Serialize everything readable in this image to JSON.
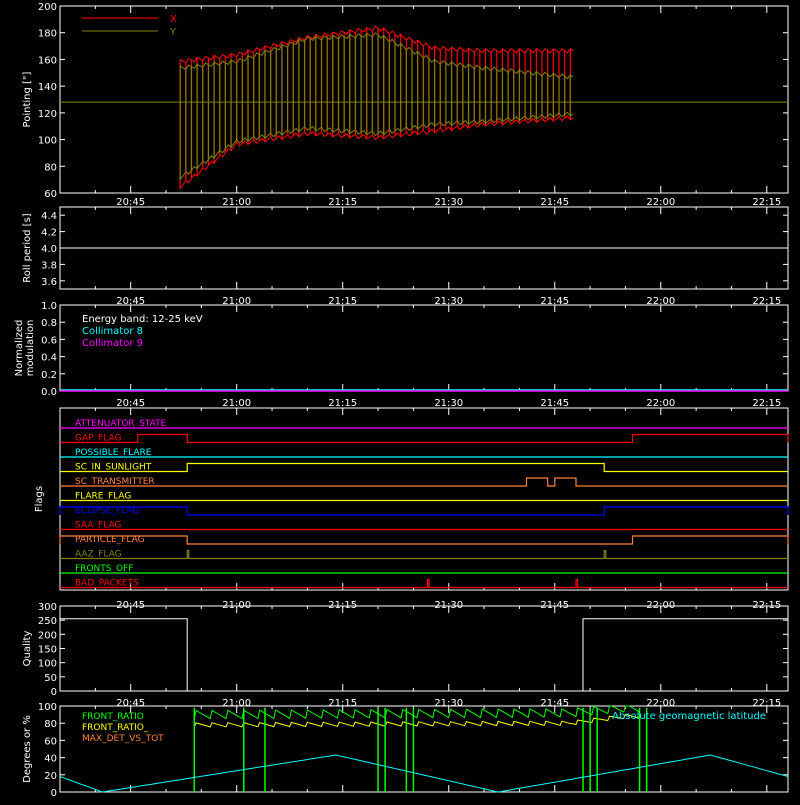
{
  "colors": {
    "background": "#000000",
    "axis": "#ffffff",
    "x": "#ff0000",
    "y": "#808000",
    "collimator8": "#00ffff",
    "collimator9": "#ff00ff",
    "front_ratio": "#00ff00",
    "front_ratio2": "#ffff00",
    "max_det": "#ff8040",
    "latitude": "#00ffff"
  },
  "time_axis": {
    "range": [
      "20:35",
      "22:18"
    ],
    "tick_labels": [
      "20:45",
      "21:00",
      "21:15",
      "21:30",
      "21:45",
      "22:00",
      "22:15"
    ]
  },
  "chart_data": [
    {
      "type": "line",
      "ylabel": "Pointing [\"]",
      "ylim": [
        60,
        200
      ],
      "yticks": [
        "60",
        "80",
        "100",
        "120",
        "140",
        "160",
        "180",
        "200"
      ],
      "legend_position": "top-left",
      "series": [
        {
          "name": "X",
          "time_span": [
            "20:52",
            "21:48"
          ],
          "envelope_time": [
            "20:52",
            "21:00",
            "21:10",
            "21:20",
            "21:28",
            "21:35",
            "21:48"
          ],
          "upper": [
            160,
            165,
            178,
            185,
            170,
            168,
            168
          ],
          "lower": [
            63,
            95,
            103,
            100,
            105,
            110,
            115
          ]
        },
        {
          "name": "Y",
          "time_span": [
            "20:52",
            "21:48"
          ],
          "envelope_time": [
            "20:52",
            "21:00",
            "21:10",
            "21:20",
            "21:28",
            "21:35",
            "21:48"
          ],
          "upper": [
            155,
            160,
            177,
            180,
            160,
            155,
            148
          ],
          "lower": [
            70,
            97,
            107,
            103,
            110,
            112,
            118
          ],
          "constant_line": 128
        }
      ]
    },
    {
      "type": "line",
      "ylabel": "Roll period [s]",
      "ylim": [
        3.5,
        4.5
      ],
      "yticks": [
        "3.6",
        "3.8",
        "4.0",
        "4.2",
        "4.4"
      ],
      "series": [
        {
          "x": [
            "20:35",
            "22:18"
          ],
          "values": [
            4.0,
            4.0
          ]
        }
      ]
    },
    {
      "type": "line",
      "ylabel": "Normalized modulation",
      "ylabel_lines": [
        "Normalized",
        "modulation"
      ],
      "ylim": [
        0,
        1
      ],
      "yticks": [
        "0.0",
        "0.2",
        "0.4",
        "0.6",
        "0.8",
        "1.0"
      ],
      "annotations": [
        "Energy band: 12-25 keV"
      ],
      "legend_position": "top-left",
      "series": [
        {
          "name": "Collimator 8",
          "values": [
            0,
            0
          ]
        },
        {
          "name": "Collimator 9",
          "values": [
            0,
            0
          ]
        }
      ]
    },
    {
      "type": "line",
      "ylabel": "Flags",
      "flags": [
        {
          "name": "ATTENUATOR_STATE",
          "color": "#ff00ff",
          "segments": []
        },
        {
          "name": "GAP_FLAG",
          "color": "#ff0000",
          "segments": [
            [
              "20:46",
              "20:53"
            ],
            [
              "21:56",
              "22:18"
            ]
          ]
        },
        {
          "name": "POSSIBLE_FLARE",
          "color": "#00ffff",
          "segments": []
        },
        {
          "name": "SC_IN_SUNLIGHT",
          "color": "#ffff00",
          "segments": [
            [
              "20:53",
              "21:52"
            ]
          ]
        },
        {
          "name": "SC_TRANSMITTER",
          "color": "#ff8040",
          "segments": [
            [
              "21:41",
              "21:44"
            ],
            [
              "21:45",
              "21:48"
            ]
          ]
        },
        {
          "name": "FLARE_FLAG",
          "color": "#ffff00",
          "segments": []
        },
        {
          "name": "ECLIPSE_FLAG",
          "color": "#0000ff",
          "segments": [
            [
              "20:35",
              "20:53"
            ],
            [
              "21:52",
              "22:18"
            ]
          ]
        },
        {
          "name": "SAA_FLAG",
          "color": "#ff0000",
          "segments": []
        },
        {
          "name": "PARTICLE_FLAG",
          "color": "#ff8040",
          "segments": [
            [
              "20:35",
              "20:53"
            ],
            [
              "21:56",
              "22:18"
            ]
          ]
        },
        {
          "name": "AAZ_FLAG",
          "color": "#808000",
          "segments": [
            [
              "20:53",
              "20:53"
            ],
            [
              "21:52",
              "21:52"
            ]
          ]
        },
        {
          "name": "FRONTS_OFF",
          "color": "#00ff00",
          "segments": []
        },
        {
          "name": "BAD_PACKETS",
          "color": "#ff0000",
          "segments": [
            [
              "21:27",
              "21:27"
            ],
            [
              "21:48",
              "21:48"
            ]
          ]
        }
      ]
    },
    {
      "type": "line",
      "ylabel": "Quality",
      "ylim": [
        0,
        300
      ],
      "yticks": [
        "0",
        "50",
        "100",
        "150",
        "200",
        "250",
        "300"
      ],
      "series": [
        {
          "x": [
            "20:35",
            "20:53",
            "20:53",
            "21:49",
            "21:49",
            "22:18"
          ],
          "values": [
            255,
            255,
            0,
            0,
            255,
            255
          ]
        }
      ]
    },
    {
      "type": "line",
      "ylabel": "Degrees or %",
      "ylim": [
        0,
        100
      ],
      "yticks": [
        "0",
        "20",
        "40",
        "60",
        "80",
        "100"
      ],
      "legend_position": "top-left",
      "annotations": [
        "Absolute geomagnetic latitude"
      ],
      "series": [
        {
          "name": "FRONT_RATIO",
          "x": [
            "20:54",
            "21:47",
            "21:55"
          ],
          "values": [
            90,
            92,
            98
          ]
        },
        {
          "name": "FRONT_RATIO_",
          "x": [
            "20:54",
            "21:47",
            "21:55"
          ],
          "values": [
            78,
            80,
            88
          ]
        },
        {
          "name": "MAX_DET_VS_TOT",
          "values": []
        },
        {
          "name": "latitude",
          "x": [
            "20:35",
            "20:41",
            "21:14",
            "21:37",
            "22:07",
            "22:18"
          ],
          "values": [
            18,
            0,
            43,
            0,
            43,
            18
          ]
        }
      ]
    }
  ]
}
